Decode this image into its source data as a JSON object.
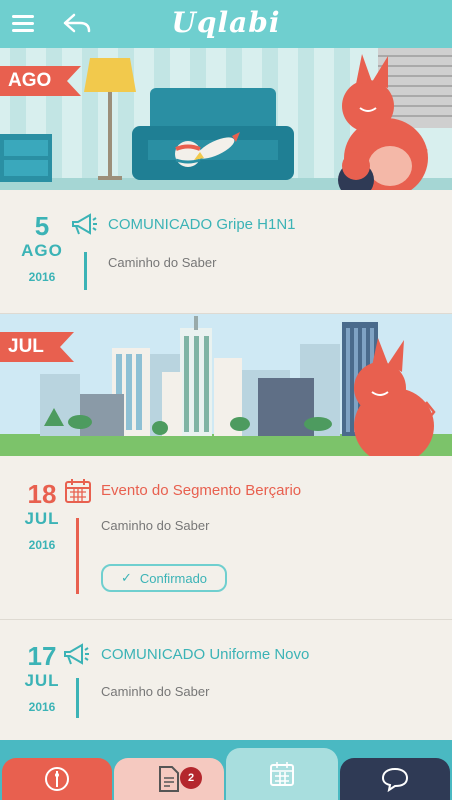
{
  "app": {
    "logo": "Uqlabi"
  },
  "banners": [
    {
      "month_tag": "AGO"
    },
    {
      "month_tag": "JUL"
    }
  ],
  "events": [
    {
      "day": "5",
      "month": "AGO",
      "year": "2016",
      "title": "COMUNICADO Gripe H1N1",
      "source": "Caminho do Saber",
      "type": "announcement",
      "color": "#3bb3b6"
    },
    {
      "day": "18",
      "month": "JUL",
      "year": "2016",
      "title": "Evento do Segmento Berçario",
      "source": "Caminho do Saber",
      "type": "calendar-event",
      "color": "#e8604f",
      "status_label": "Confirmado"
    },
    {
      "day": "17",
      "month": "JUL",
      "year": "2016",
      "title": "COMUNICADO Uniforme Novo",
      "source": "Caminho do Saber",
      "type": "announcement",
      "color": "#3bb3b6"
    }
  ],
  "bottom_tabs": [
    {
      "icon": "info-icon",
      "color": "#e8604f"
    },
    {
      "icon": "document-icon",
      "color": "#f5c9c0",
      "badge": "2"
    },
    {
      "icon": "calendar-icon",
      "color": "#6fcfcf"
    },
    {
      "icon": "chat-icon",
      "color": "#2f3a55"
    }
  ]
}
